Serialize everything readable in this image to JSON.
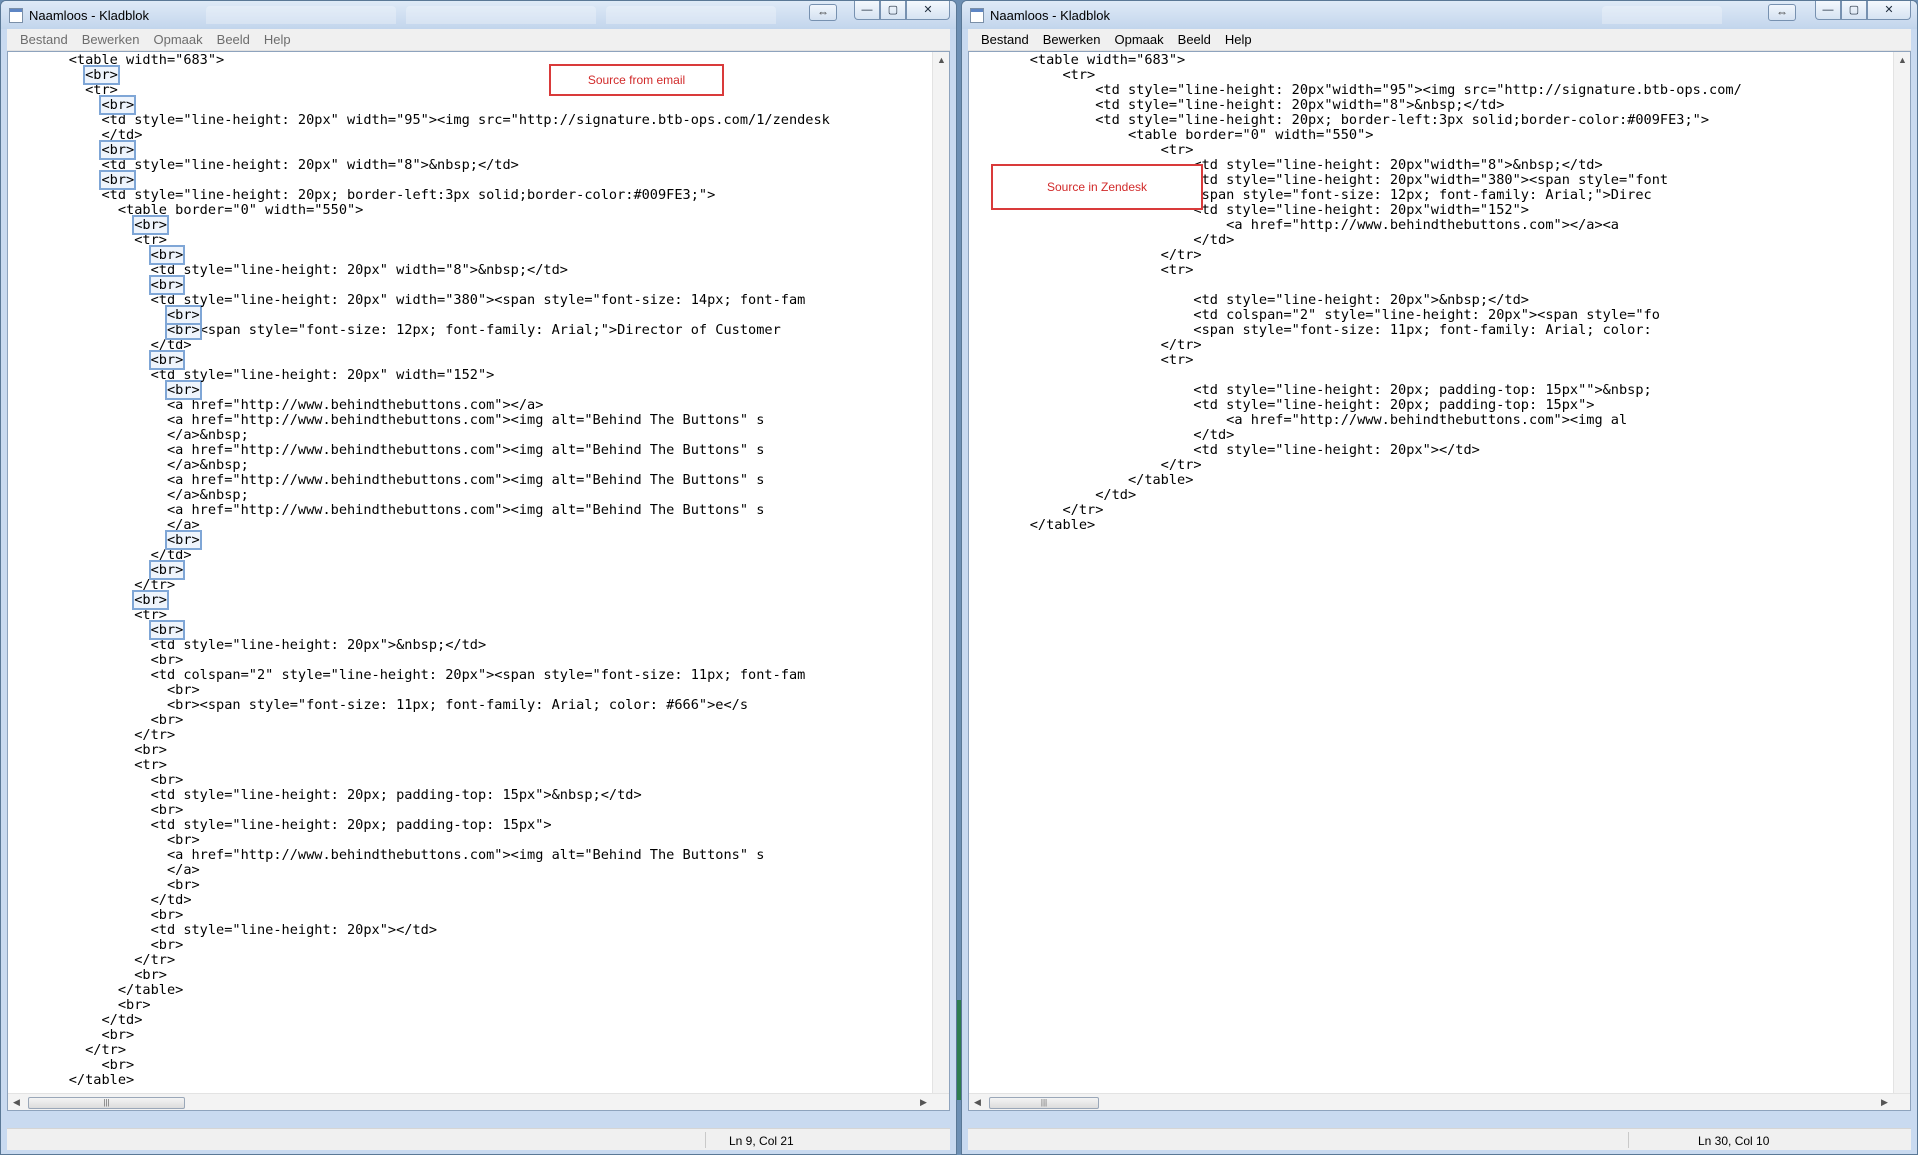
{
  "left_window": {
    "title": "Naamloos - Kladblok",
    "menu": [
      "Bestand",
      "Bewerken",
      "Opmaak",
      "Beeld",
      "Help"
    ],
    "annotation": "Source from email",
    "status": "Ln 9, Col 21",
    "lines": [
      {
        "indent": 4,
        "text": "<table width=\"683\">"
      },
      {
        "indent": 6,
        "text": "<br>",
        "hl": true
      },
      {
        "indent": 6,
        "text": "<tr>"
      },
      {
        "indent": 8,
        "text": "<br>",
        "hl": true
      },
      {
        "indent": 8,
        "text": "<td style=\"line-height: 20px\" width=\"95\"><img src=\"http://signature.btb-ops.com/1/zendesk"
      },
      {
        "indent": 8,
        "text": "</td>"
      },
      {
        "indent": 8,
        "text": "<br>",
        "hl": true
      },
      {
        "indent": 8,
        "text": "<td style=\"line-height: 20px\" width=\"8\">&nbsp;</td>"
      },
      {
        "indent": 8,
        "text": "<br>",
        "hl": true
      },
      {
        "indent": 8,
        "text": "<td style=\"line-height: 20px; border-left:3px solid;border-color:#009FE3;\">"
      },
      {
        "indent": 10,
        "text": "<table border=\"0\" width=\"550\">"
      },
      {
        "indent": 12,
        "text": "<br>",
        "hl": true
      },
      {
        "indent": 12,
        "text": "<tr>"
      },
      {
        "indent": 14,
        "text": "<br>",
        "hl": true
      },
      {
        "indent": 14,
        "text": "<td style=\"line-height: 20px\" width=\"8\">&nbsp;</td>"
      },
      {
        "indent": 14,
        "text": "<br>",
        "hl": true
      },
      {
        "indent": 14,
        "text": "<td style=\"line-height: 20px\" width=\"380\"><span style=\"font-size: 14px; font-fam"
      },
      {
        "indent": 16,
        "text": "<br>",
        "hl": true
      },
      {
        "indent": 16,
        "text": "<br><span style=\"font-size: 12px; font-family: Arial;\">Director of Customer",
        "hlprefix": 4
      },
      {
        "indent": 14,
        "text": "</td>"
      },
      {
        "indent": 14,
        "text": "<br>",
        "hl": true
      },
      {
        "indent": 14,
        "text": "<td style=\"line-height: 20px\" width=\"152\">"
      },
      {
        "indent": 16,
        "text": "<br>",
        "hl": true
      },
      {
        "indent": 16,
        "text": "<a href=\"http://www.behindthebuttons.com\"></a>"
      },
      {
        "indent": 16,
        "text": "<a href=\"http://www.behindthebuttons.com\"><img alt=\"Behind The Buttons\" s"
      },
      {
        "indent": 16,
        "text": "</a>&nbsp;"
      },
      {
        "indent": 16,
        "text": "<a href=\"http://www.behindthebuttons.com\"><img alt=\"Behind The Buttons\" s"
      },
      {
        "indent": 16,
        "text": "</a>&nbsp;"
      },
      {
        "indent": 16,
        "text": "<a href=\"http://www.behindthebuttons.com\"><img alt=\"Behind The Buttons\" s"
      },
      {
        "indent": 16,
        "text": "</a>&nbsp;"
      },
      {
        "indent": 16,
        "text": "<a href=\"http://www.behindthebuttons.com\"><img alt=\"Behind The Buttons\" s"
      },
      {
        "indent": 16,
        "text": "</a>"
      },
      {
        "indent": 16,
        "text": "<br>",
        "hl": true
      },
      {
        "indent": 14,
        "text": "</td>"
      },
      {
        "indent": 14,
        "text": "<br>",
        "hl": true
      },
      {
        "indent": 12,
        "text": "</tr>"
      },
      {
        "indent": 12,
        "text": "<br>",
        "hl": true
      },
      {
        "indent": 12,
        "text": "<tr>"
      },
      {
        "indent": 14,
        "text": "<br>",
        "hl": true
      },
      {
        "indent": 14,
        "text": "<td style=\"line-height: 20px\">&nbsp;</td>"
      },
      {
        "indent": 14,
        "text": "<br>"
      },
      {
        "indent": 14,
        "text": "<td colspan=\"2\" style=\"line-height: 20px\"><span style=\"font-size: 11px; font-fam"
      },
      {
        "indent": 16,
        "text": "<br>"
      },
      {
        "indent": 16,
        "text": "<br><span style=\"font-size: 11px; font-family: Arial; color: #666\">e</s"
      },
      {
        "indent": 14,
        "text": "<br>"
      },
      {
        "indent": 12,
        "text": "</tr>"
      },
      {
        "indent": 12,
        "text": "<br>"
      },
      {
        "indent": 12,
        "text": "<tr>"
      },
      {
        "indent": 14,
        "text": "<br>"
      },
      {
        "indent": 14,
        "text": "<td style=\"line-height: 20px; padding-top: 15px\">&nbsp;</td>"
      },
      {
        "indent": 14,
        "text": "<br>"
      },
      {
        "indent": 14,
        "text": "<td style=\"line-height: 20px; padding-top: 15px\">"
      },
      {
        "indent": 16,
        "text": "<br>"
      },
      {
        "indent": 16,
        "text": "<a href=\"http://www.behindthebuttons.com\"><img alt=\"Behind The Buttons\" s"
      },
      {
        "indent": 16,
        "text": "</a>"
      },
      {
        "indent": 16,
        "text": "<br>"
      },
      {
        "indent": 14,
        "text": "</td>"
      },
      {
        "indent": 14,
        "text": "<br>"
      },
      {
        "indent": 14,
        "text": "<td style=\"line-height: 20px\"></td>"
      },
      {
        "indent": 14,
        "text": "<br>"
      },
      {
        "indent": 12,
        "text": "</tr>"
      },
      {
        "indent": 12,
        "text": "<br>"
      },
      {
        "indent": 10,
        "text": "</table>"
      },
      {
        "indent": 10,
        "text": "<br>"
      },
      {
        "indent": 8,
        "text": "</td>"
      },
      {
        "indent": 8,
        "text": "<br>"
      },
      {
        "indent": 6,
        "text": "</tr>"
      },
      {
        "indent": 8,
        "text": "<br>"
      },
      {
        "indent": 4,
        "text": "</table>"
      }
    ]
  },
  "right_window": {
    "title": "Naamloos - Kladblok",
    "menu": [
      "Bestand",
      "Bewerken",
      "Opmaak",
      "Beeld",
      "Help"
    ],
    "annotation": "Source in Zendesk",
    "status": "Ln 30, Col 10",
    "lines": [
      {
        "indent": 4,
        "text": "<table width=\"683\">"
      },
      {
        "indent": 8,
        "text": "<tr>"
      },
      {
        "indent": 12,
        "text": "<td style=\"line-height: 20px\"width=\"95\"><img src=\"http://signature.btb-ops.com/"
      },
      {
        "indent": 12,
        "text": "<td style=\"line-height: 20px\"width=\"8\">&nbsp;</td>"
      },
      {
        "indent": 12,
        "text": "<td style=\"line-height: 20px; border-left:3px solid;border-color:#009FE3;\">"
      },
      {
        "indent": 16,
        "text": "<table border=\"0\" width=\"550\">"
      },
      {
        "indent": 20,
        "text": "<tr>"
      },
      {
        "indent": 24,
        "text": "<td style=\"line-height: 20px\"width=\"8\">&nbsp;</td>"
      },
      {
        "indent": 24,
        "text": "<td style=\"line-height: 20px\"width=\"380\"><span style=\"font"
      },
      {
        "indent": 24,
        "text": "<span style=\"font-size: 12px; font-family: Arial;\">Direc"
      },
      {
        "indent": 24,
        "text": "<td style=\"line-height: 20px\"width=\"152\">"
      },
      {
        "indent": 28,
        "text": "<a href=\"http://www.behindthebuttons.com\"></a><a"
      },
      {
        "indent": 24,
        "text": "</td>"
      },
      {
        "indent": 20,
        "text": "</tr>"
      },
      {
        "indent": 20,
        "text": "<tr>"
      },
      {
        "indent": 0,
        "text": ""
      },
      {
        "indent": 24,
        "text": "<td style=\"line-height: 20px\">&nbsp;</td>"
      },
      {
        "indent": 24,
        "text": "<td colspan=\"2\" style=\"line-height: 20px\"><span style=\"fo"
      },
      {
        "indent": 24,
        "text": "<span style=\"font-size: 11px; font-family: Arial; color:"
      },
      {
        "indent": 20,
        "text": "</tr>"
      },
      {
        "indent": 20,
        "text": "<tr>"
      },
      {
        "indent": 0,
        "text": ""
      },
      {
        "indent": 24,
        "text": "<td style=\"line-height: 20px; padding-top: 15px\"\">&nbsp;"
      },
      {
        "indent": 24,
        "text": "<td style=\"line-height: 20px; padding-top: 15px\">"
      },
      {
        "indent": 28,
        "text": "<a href=\"http://www.behindthebuttons.com\"><img al"
      },
      {
        "indent": 24,
        "text": "</td>"
      },
      {
        "indent": 24,
        "text": "<td style=\"line-height: 20px\"></td>"
      },
      {
        "indent": 20,
        "text": "</tr>"
      },
      {
        "indent": 16,
        "text": "</table>"
      },
      {
        "indent": 12,
        "text": "</td>"
      },
      {
        "indent": 8,
        "text": "</tr>"
      },
      {
        "indent": 4,
        "text": "</table>"
      }
    ]
  },
  "colors": {
    "annotation_border": "#d93a3a",
    "br_highlight": "#7fa6d6",
    "title_bar": "#c9daf0"
  },
  "icons": {
    "window_icon": "notepad-icon",
    "minimize": "minimize-icon",
    "maximize": "maximize-icon",
    "close": "close-icon",
    "resize": "resize-icon"
  }
}
